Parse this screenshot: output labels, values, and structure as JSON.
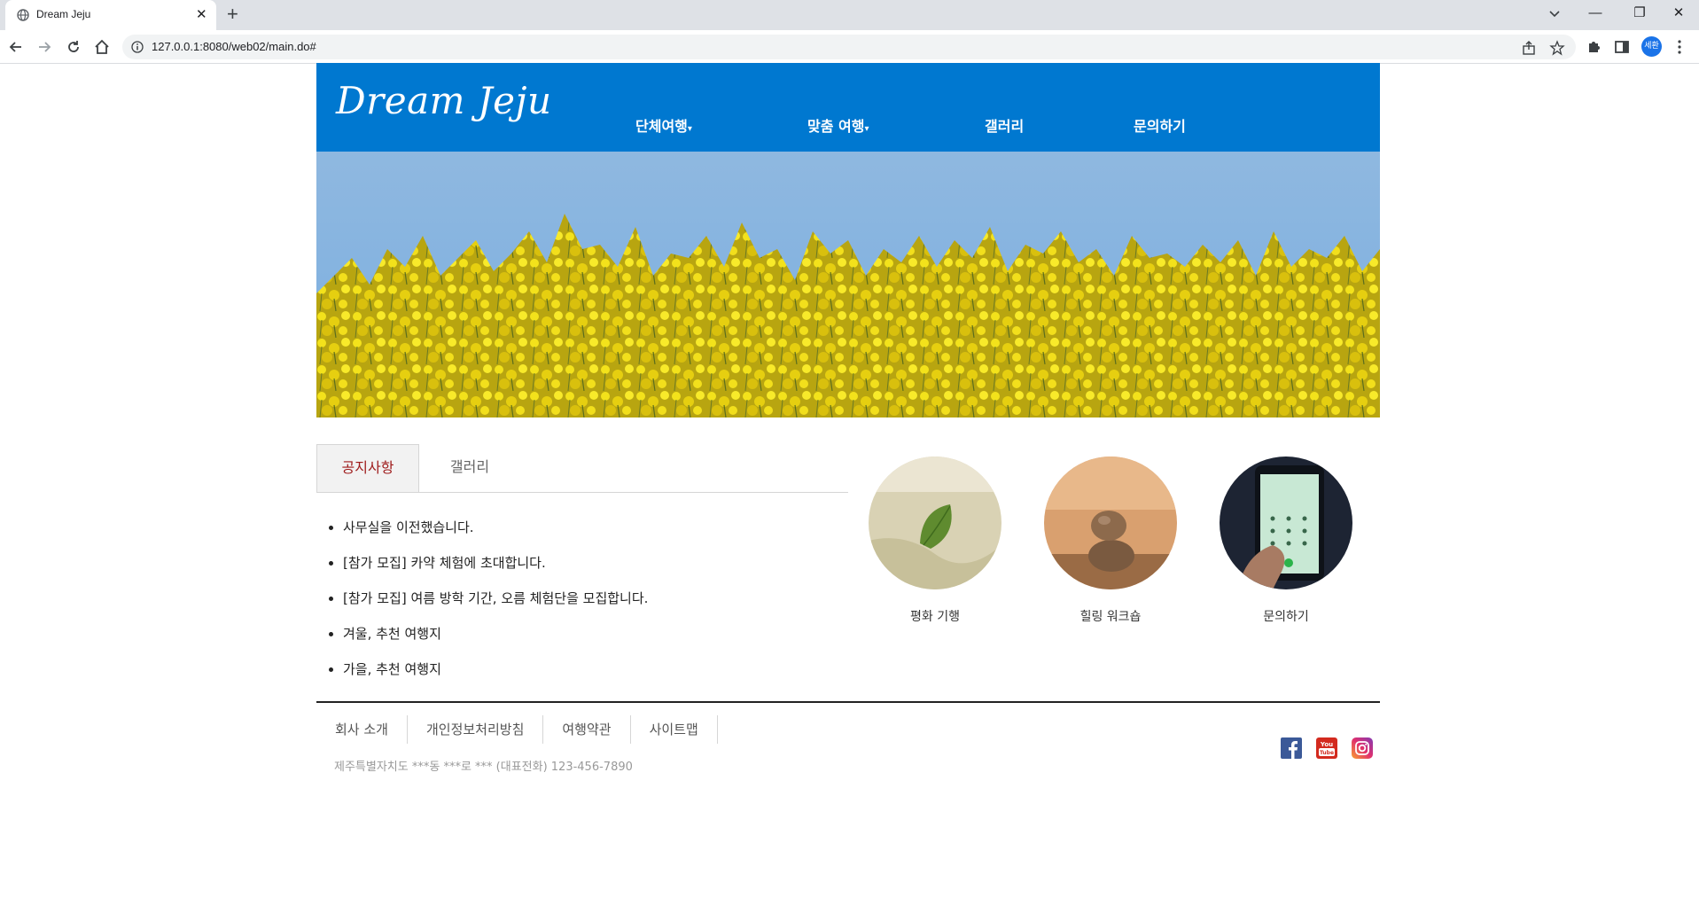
{
  "browser": {
    "tab_title": "Dream Jeju",
    "tab_close": "✕",
    "new_tab": "+",
    "url": "127.0.0.1:8080/web02/main.do#",
    "profile_label": "세환",
    "window_minimize": "—",
    "window_restore": "❐",
    "window_close": "✕"
  },
  "header": {
    "logo": "Dream Jeju",
    "nav": [
      {
        "label": "단체여행",
        "caret": "▾"
      },
      {
        "label": "맞춤 여행",
        "caret": "▾"
      },
      {
        "label": "갤러리",
        "caret": ""
      },
      {
        "label": "문의하기",
        "caret": ""
      }
    ]
  },
  "tabs": {
    "notice_label": "공지사항",
    "gallery_label": "갤러리",
    "notices": [
      "사무실을 이전했습니다.",
      "[참가 모집] 카약 체험에 초대합니다.",
      "[참가 모집] 여름 방학 기간, 오름 체험단을 모집합니다.",
      "겨울, 추천 여행지",
      "가을, 추천 여행지"
    ]
  },
  "features": [
    {
      "label": "평화 기행"
    },
    {
      "label": "힐링 워크숍"
    },
    {
      "label": "문의하기"
    }
  ],
  "footer": {
    "links": [
      "회사 소개",
      "개인정보처리방침",
      "여행약관",
      "사이트맵"
    ],
    "address": "제주특별자치도 ***동 ***로 *** (대표전화) 123-456-7890"
  },
  "colors": {
    "brand_blue": "#0078d0",
    "active_tab": "#9e1a1a"
  }
}
